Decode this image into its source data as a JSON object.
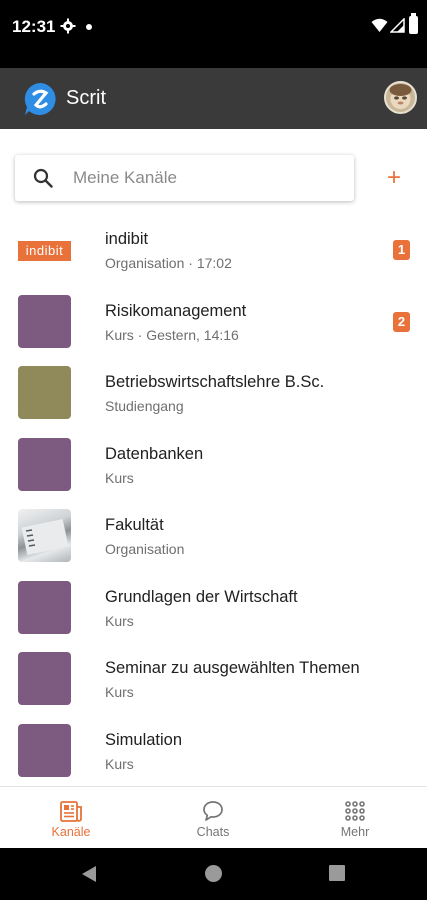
{
  "status_bar": {
    "time": "12:31"
  },
  "app_bar": {
    "title": "Scrit",
    "brand_color": "#2f8de4"
  },
  "search": {
    "placeholder": "Meine Kanäle",
    "value": "",
    "add_label": "+"
  },
  "accent_color": "#e8723a",
  "channels": [
    {
      "name": "indibit",
      "subtitle": "Organisation · 17:02",
      "badge": "1",
      "thumb": "logo",
      "logo_text": "indibit"
    },
    {
      "name": "Risikomanagement",
      "subtitle": "Kurs · Gestern, 14:16",
      "badge": "2",
      "thumb": "purple"
    },
    {
      "name": "Betriebswirtschaftslehre B.Sc.",
      "subtitle": "Studiengang",
      "badge": "",
      "thumb": "olive"
    },
    {
      "name": "Datenbanken",
      "subtitle": "Kurs",
      "badge": "",
      "thumb": "purple"
    },
    {
      "name": "Fakultät",
      "subtitle": "Organisation",
      "badge": "",
      "thumb": "photo"
    },
    {
      "name": "Grundlagen der Wirtschaft",
      "subtitle": "Kurs",
      "badge": "",
      "thumb": "purple"
    },
    {
      "name": "Seminar zu ausgewählten Themen",
      "subtitle": "Kurs",
      "badge": "",
      "thumb": "purple"
    },
    {
      "name": "Simulation",
      "subtitle": "Kurs",
      "badge": "",
      "thumb": "purple"
    }
  ],
  "thumb_colors": {
    "purple": "#7d5a80",
    "olive": "#908a5b"
  },
  "bottom_nav": [
    {
      "label": "Kanäle",
      "icon": "channels-icon",
      "active": true
    },
    {
      "label": "Chats",
      "icon": "chat-bubble-icon",
      "active": false
    },
    {
      "label": "Mehr",
      "icon": "grid-dots-icon",
      "active": false
    }
  ],
  "nav_colors": {
    "active": "#e8723a",
    "inactive": "#757575"
  }
}
